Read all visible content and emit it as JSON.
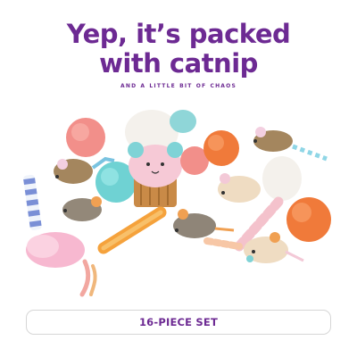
{
  "headline": {
    "line1": "Yep, it’s packed",
    "line2": "with catnip"
  },
  "tagline": "and a little bit of chaos",
  "set_label": "16-PIECE SET",
  "colors": {
    "brand_purple": "#6d2a93",
    "pill_border": "#d6d6d6",
    "background": "#ffffff"
  }
}
